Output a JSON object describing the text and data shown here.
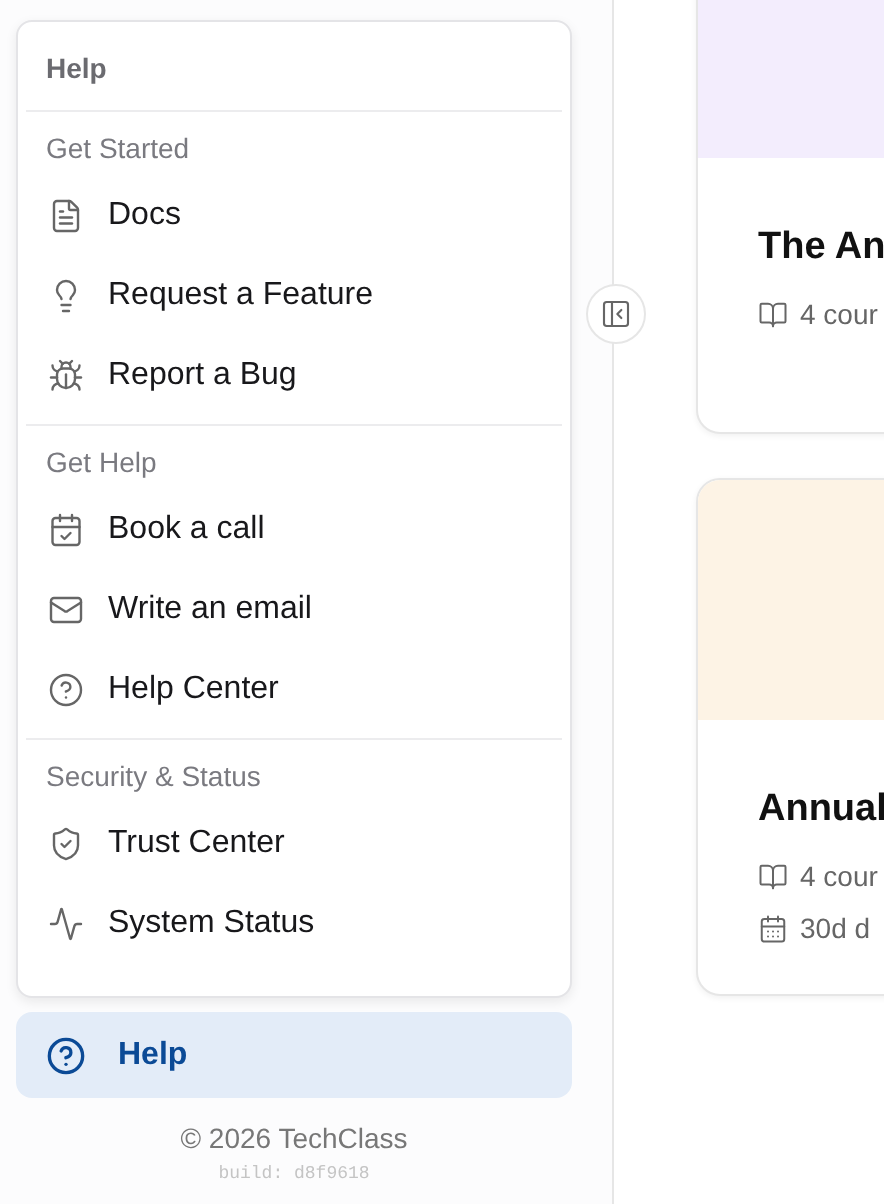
{
  "help_menu": {
    "title": "Help",
    "sections": [
      {
        "label": "Get Started",
        "items": [
          "Docs",
          "Request a Feature",
          "Report a Bug"
        ]
      },
      {
        "label": "Get Help",
        "items": [
          "Book a call",
          "Write an email",
          "Help Center"
        ]
      },
      {
        "label": "Security & Status",
        "items": [
          "Trust Center",
          "System Status"
        ]
      }
    ]
  },
  "help_button": {
    "label": "Help",
    "selected": true
  },
  "footer": {
    "copyright": "© 2026 TechClass",
    "build": "build: d8f9618"
  },
  "cards": [
    {
      "title": "The An",
      "color": "#f3edfd",
      "meta": [
        "4 cour"
      ]
    },
    {
      "title": "Annual",
      "color": "#fdf3e5",
      "meta": [
        "4 cour",
        "30d d"
      ]
    }
  ]
}
